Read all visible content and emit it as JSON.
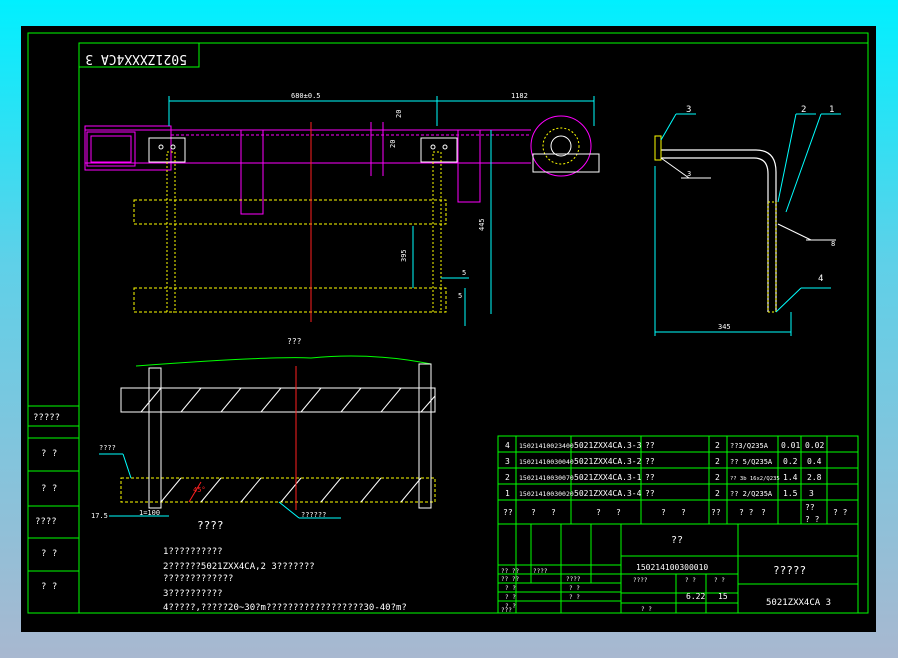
{
  "title_block_mirrored": "5021ZXXX4CA 3",
  "dimensions": {
    "top_span": "680±0.5",
    "right_span": "1182",
    "small_a": "20",
    "small_b": "20",
    "height_445": "445",
    "height_395": "395",
    "gap_5a": "5",
    "gap_5b": "5",
    "side_345": "345",
    "bottom_5": "5",
    "bottom_left_5": "17.5",
    "bottom_1": "1=100",
    "angle": "45°"
  },
  "balloons": [
    "3",
    "2",
    "1",
    "4"
  ],
  "side_marks": {
    "a": "3",
    "b": "8"
  },
  "section_label": "???",
  "weld_label_left": "????",
  "weld_label_bottom": "??????",
  "left_column": [
    "?????",
    "? ?",
    "? ?",
    "????",
    "? ?",
    "? ?"
  ],
  "notes_title": "????",
  "notes": [
    "1??????????",
    "2??????5021ZXX4CA,2 3???????",
    "  ?????????????",
    "3??????????",
    "4?????,?????20~30?m??????????????????30-40?m?"
  ],
  "bom_rows": [
    {
      "no": "4",
      "code": "15021410023400",
      "name": "5021ZXX4CA.3-3",
      "desc": "??",
      "qty": "2",
      "mat": "??3/Q235A",
      "w1": "0.01",
      "w2": "0.02"
    },
    {
      "no": "3",
      "code": "15021410030040",
      "name": "5021ZXX4CA.3-2",
      "desc": "??",
      "qty": "2",
      "mat": "?? 5/Q235A",
      "w1": "0.2",
      "w2": "0.4"
    },
    {
      "no": "2",
      "code": "15021410030070",
      "name": "5021ZXX4CA.3-1",
      "desc": "??",
      "qty": "2",
      "mat": "?? 3b 16x2/Q235",
      "w1": "1.4",
      "w2": "2.8"
    },
    {
      "no": "1",
      "code": "15021410030020",
      "name": "5021ZXX4CA.3-4",
      "desc": "??",
      "qty": "2",
      "mat": "?? 2/Q235A",
      "w1": "1.5",
      "w2": "3"
    }
  ],
  "bom_header": [
    "??",
    "?",
    "?",
    "?",
    "?",
    "?",
    "?",
    "??",
    "? ?",
    "?",
    "??",
    "? ?",
    "? ?"
  ],
  "title_block": {
    "top_label": "??",
    "drawing_code": "150214100300010",
    "company": "?????",
    "drawing_no": "5021ZXX4CA 3",
    "scale": "6.22",
    "sheet": "15",
    "row_labels": [
      "?? ??",
      "????",
      "?? ??",
      "? ?",
      "? ?",
      "? ?",
      "???"
    ],
    "mid_labels": [
      "????",
      "? ?",
      "? ?"
    ],
    "sub_labels": [
      "????",
      "? ?",
      "? ?",
      "? ?"
    ]
  },
  "colors": {
    "frame": "#00ff00",
    "cad_white": "#ffffff",
    "magenta": "#ff00ff",
    "yellow": "#ffff00",
    "cyan": "#00ffff",
    "red": "#ff2020"
  }
}
